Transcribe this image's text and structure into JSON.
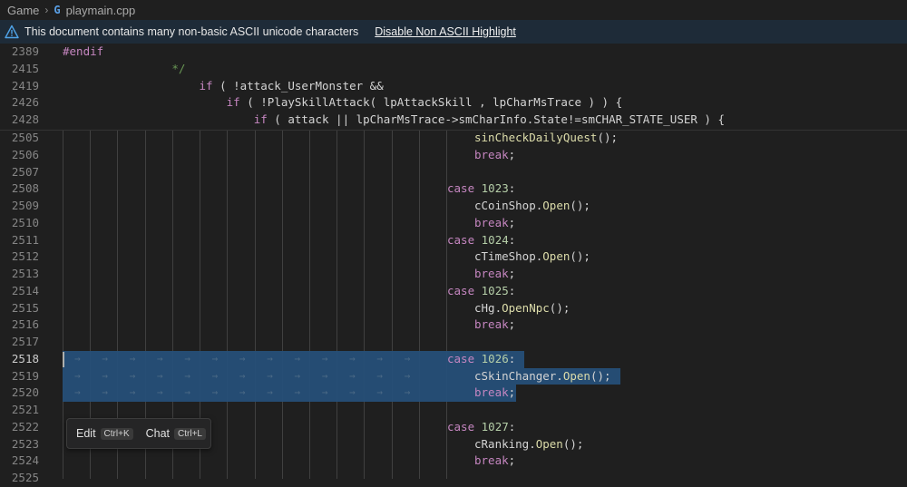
{
  "breadcrumb": {
    "folder": "Game",
    "file_icon": "G",
    "file": "playmain.cpp"
  },
  "banner": {
    "message": "This document contains many non-basic ASCII unicode characters",
    "action": "Disable Non ASCII Highlight"
  },
  "sticky_lines": [
    {
      "ln": "2389",
      "text": "#endif"
    },
    {
      "ln": "2415",
      "text": "                */"
    },
    {
      "ln": "2419",
      "text": "                    if ( !attack_UserMonster &&"
    },
    {
      "ln": "2426",
      "text": "                        if ( !PlaySkillAttack( lpAttackSkill , lpCharMsTrace ) ) {"
    },
    {
      "ln": "2428",
      "text": "                            if ( attack || lpCharMsTrace->smCharInfo.State!=smCHAR_STATE_USER ) {"
    }
  ],
  "lines": [
    {
      "ln": "2505",
      "text": "sinCheckDailyQuest();"
    },
    {
      "ln": "2506",
      "text": "break;"
    },
    {
      "ln": "2507",
      "text": ""
    },
    {
      "ln": "2508",
      "text": "case 1023:"
    },
    {
      "ln": "2509",
      "text": "cCoinShop.Open();"
    },
    {
      "ln": "2510",
      "text": "break;"
    },
    {
      "ln": "2511",
      "text": "case 1024:"
    },
    {
      "ln": "2512",
      "text": "cTimeShop.Open();"
    },
    {
      "ln": "2513",
      "text": "break;"
    },
    {
      "ln": "2514",
      "text": "case 1025:"
    },
    {
      "ln": "2515",
      "text": "cHg.OpenNpc();"
    },
    {
      "ln": "2516",
      "text": "break;"
    },
    {
      "ln": "2517",
      "text": ""
    },
    {
      "ln": "2518",
      "text": "case 1026:"
    },
    {
      "ln": "2519",
      "text": "cSkinChanger.Open();"
    },
    {
      "ln": "2520",
      "text": "break;"
    },
    {
      "ln": "2521",
      "text": ""
    },
    {
      "ln": "2522",
      "text": "case 1027:"
    },
    {
      "ln": "2523",
      "text": "cRanking.Open();"
    },
    {
      "ln": "2524",
      "text": "break;"
    },
    {
      "ln": "2525",
      "text": ""
    }
  ],
  "active_line": "2518",
  "tooltip": {
    "edit_label": "Edit",
    "edit_shortcut": "Ctrl+K",
    "chat_label": "Chat",
    "chat_shortcut": "Ctrl+L"
  },
  "colors": {
    "selection": "#264f78",
    "banner_bg": "#1e2b38",
    "editor_bg": "#1f1f1f"
  }
}
